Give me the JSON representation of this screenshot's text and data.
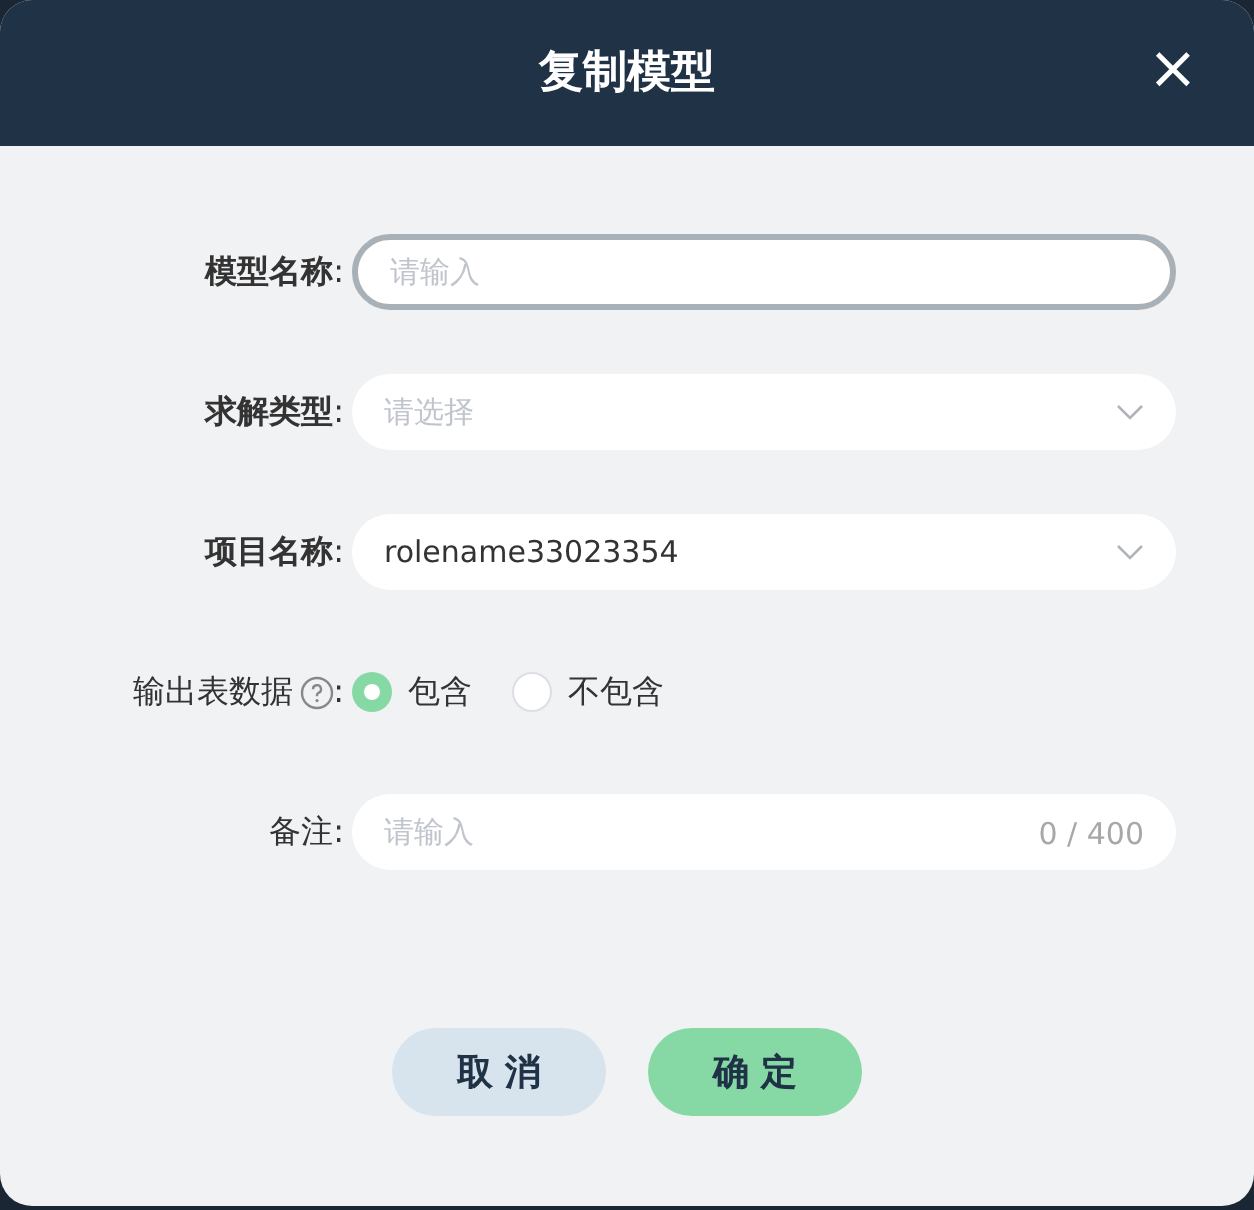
{
  "dialog": {
    "title": "复制模型",
    "close": "×"
  },
  "fields": [
    {
      "kind": "input",
      "label": "模型名称",
      "colon": ":",
      "bold": true,
      "focused": true,
      "placeholder": "请输入"
    },
    {
      "kind": "select",
      "label": "求解类型",
      "colon": ":",
      "bold": true,
      "placeholder": "请选择"
    },
    {
      "kind": "select",
      "label": "项目名称",
      "colon": ":",
      "bold": true,
      "value": "rolename33023354"
    },
    {
      "kind": "radio",
      "label": "输出表数据",
      "colon": ":",
      "bold": false,
      "help": true,
      "options": [
        {
          "label": "包含",
          "selected": true
        },
        {
          "label": "不包含",
          "selected": false
        }
      ]
    },
    {
      "kind": "input",
      "label": "备注",
      "colon": ":",
      "bold": false,
      "focused": false,
      "placeholder": "请输入",
      "counter": "0 / 400"
    }
  ],
  "buttons": [
    {
      "label": "取 消",
      "kind": "secondary"
    },
    {
      "label": "确 定",
      "kind": "primary"
    }
  ]
}
